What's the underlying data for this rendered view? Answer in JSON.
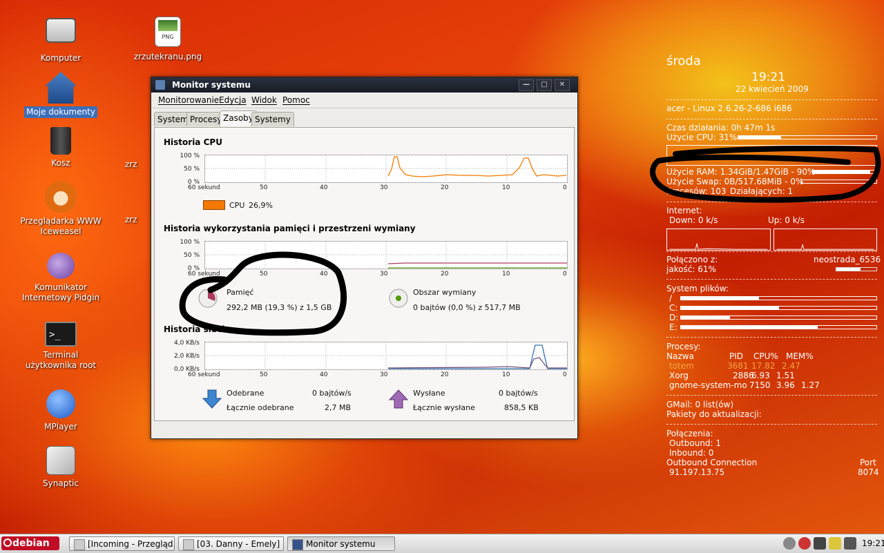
{
  "desktop": {
    "icons": [
      {
        "label": "Komputer"
      },
      {
        "label": "zrzutekranu.png",
        "badge": "PNG"
      },
      {
        "label": "Moje dokumenty"
      },
      {
        "label": "Kosz"
      },
      {
        "label": "zrz"
      },
      {
        "label": "Przeglądarka WWW Iceweasel"
      },
      {
        "label": "zrz"
      },
      {
        "label": "Komunikator Internetowy Pidgin"
      },
      {
        "label": "Terminal użytkownika root"
      },
      {
        "label": "MPlayer"
      },
      {
        "label": "Synaptic"
      }
    ]
  },
  "window": {
    "title": "Monitor systemu",
    "controls": {
      "minimize": "—",
      "maximize": "□",
      "close": "✕"
    },
    "menu": [
      "Monitorowanie",
      "Edycja",
      "Widok",
      "Pomoc"
    ],
    "tabs": [
      "System",
      "Procesy",
      "Zasoby",
      "Systemy plików"
    ],
    "active_tab": "Zasoby",
    "cpu": {
      "title": "Historia CPU",
      "y_ticks": [
        "100 %",
        "50 %",
        "0 %"
      ],
      "x_ticks": [
        "60 sekund",
        "50",
        "40",
        "30",
        "20",
        "10",
        "0"
      ],
      "legend_label": "CPU",
      "legend_value": "26,9%",
      "color": "#f57900"
    },
    "mem": {
      "title": "Historia wykorzystania pamięci i przestrzeni wymiany",
      "y_ticks": [
        "100 %",
        "50 %",
        "0 %"
      ],
      "x_ticks": [
        "60 sekund",
        "50",
        "40",
        "30",
        "20",
        "10",
        "0"
      ],
      "memory_label": "Pamięć",
      "memory_value": "292,2 MB (19,3 %) z 1,5 GB",
      "swap_label": "Obszar wymiany",
      "swap_value": "0 bajtów (0,0 %) z 517,7 MB",
      "memory_color": "#ad3a5e",
      "swap_color": "#4e9a06"
    },
    "net": {
      "title": "Historia sieci",
      "y_ticks": [
        "4,0 KB/s",
        "2,0 KB/s",
        "0,0 KB/s"
      ],
      "x_ticks": [
        "60 sekund",
        "50",
        "40",
        "30",
        "20",
        "10",
        "0"
      ],
      "received_label": "Odebrane",
      "received_value": "0 bajtów/s",
      "total_received_label": "Łącznie odebrane",
      "total_received_value": "2,7 MB",
      "sent_label": "Wysłane",
      "sent_value": "0 bajtów/s",
      "total_sent_label": "Łącznie wysłane",
      "total_sent_value": "858,5 KB",
      "received_color": "#2e6fae",
      "sent_color": "#75507b"
    }
  },
  "conky": {
    "day": "środa",
    "time": "19:21",
    "date": "22 kwiecień 2009",
    "system": "acer - Linux 2.6.26-2-686 i686",
    "uptime": "Czas działania: 0h 47m 1s",
    "cpu_usage": "Użycie CPU: 31%",
    "cpu_fraction": 0.31,
    "ram_usage": "Użycie RAM: 1.34GiB/1.47GiB - 90%",
    "ram_fraction": 0.9,
    "swap_usage": "Użycie Swap: 0B/517.68MiB - 0%",
    "swap_fraction": 0,
    "processes": "Procesów: 103",
    "running": "Działających: 1",
    "internet_label": "Internet:",
    "down": "Down: 0 k/s",
    "up": "Up: 0 k/s",
    "connected_label": "Połączono z:",
    "connected_value": "neostrada_6536",
    "quality": "jakość: 61%",
    "quality_fraction": 0.61,
    "fs_label": "System plików:",
    "filesystems": [
      {
        "name": "/",
        "used": 0.4
      },
      {
        "name": "C:",
        "used": 0.5
      },
      {
        "name": "D:",
        "used": 0.25
      },
      {
        "name": "E:",
        "used": 0.7
      }
    ],
    "proc_label": "Procesy:",
    "proc_headers": [
      "Nazwa",
      "PID",
      "CPU%",
      "MEM%"
    ],
    "proc_rows": [
      {
        "name": "totem",
        "pid": "3681",
        "cpu": "17.82",
        "mem": "2.47",
        "highlight": true
      },
      {
        "name": "Xorg",
        "pid": "2886",
        "cpu": "6.93",
        "mem": "1.51"
      },
      {
        "name": "gnome-system-mo",
        "pid": "7150",
        "cpu": "3.96",
        "mem": "1.27"
      }
    ],
    "gmail": "GMail: 0 list(ów)",
    "updates": "Pakiety do aktualizacji:",
    "connections_label": "Połączenia:",
    "outbound": "Outbound: 1",
    "inbound": "Inbound: 0",
    "outbound_connection_label": "Outbound Connection",
    "port_label": "Port",
    "conn_ip": "91.197.13.75",
    "conn_port": "8074"
  },
  "taskbar": {
    "start_label": "debian",
    "buttons": [
      "[Incoming - Przegląd...",
      "[03. Danny - Emely]",
      "Monitor systemu"
    ],
    "active_button": 2,
    "clock": "19:21"
  }
}
